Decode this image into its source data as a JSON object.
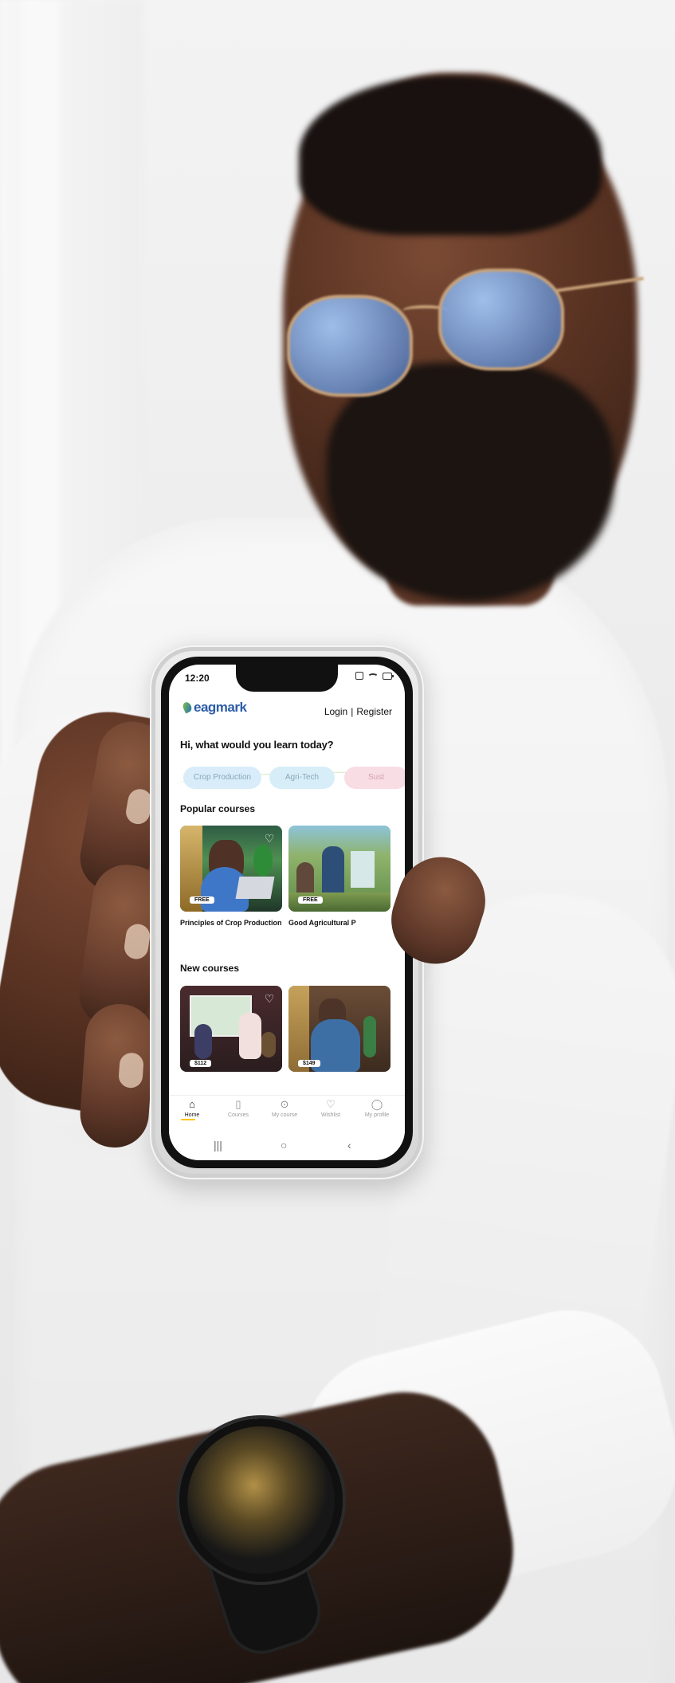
{
  "status_bar": {
    "time": "12:20",
    "icons": [
      "network-icon",
      "wifi-icon",
      "battery-icon"
    ]
  },
  "header": {
    "logo_text": "eagmark",
    "logo_tagline": "",
    "login_label": "Login",
    "separator": "|",
    "register_label": "Register"
  },
  "greeting": "Hi, what would you learn today?",
  "categories": [
    {
      "label": "Crop Production"
    },
    {
      "label": "Agri-Tech"
    },
    {
      "label": "Sust"
    }
  ],
  "sections": {
    "popular": {
      "title": "Popular courses",
      "courses": [
        {
          "title": "Principles of Crop Production",
          "badge": "FREE"
        },
        {
          "title": "Good Agricultural P",
          "badge": "FREE"
        }
      ]
    },
    "new": {
      "title": "New courses",
      "courses": [
        {
          "price": "$112"
        },
        {
          "price": "$149"
        }
      ]
    }
  },
  "bottom_nav": [
    {
      "label": "Home",
      "icon": "home-icon",
      "active": true
    },
    {
      "label": "Courses",
      "icon": "book-icon",
      "active": false
    },
    {
      "label": "My course",
      "icon": "play-circle-icon",
      "active": false
    },
    {
      "label": "Wishlist",
      "icon": "heart-icon",
      "active": false
    },
    {
      "label": "My profile",
      "icon": "user-icon",
      "active": false
    }
  ],
  "system_nav": {
    "recent": "|||",
    "home": "○",
    "back": "‹"
  },
  "icons": {
    "wishlist_heart": "♡",
    "home": "⌂",
    "courses": "▯",
    "my_course": "⊙",
    "wishlist": "♡",
    "profile": "◯"
  },
  "colors": {
    "accent": "#ffc400",
    "brand_blue": "#2c5ca7",
    "brand_green": "#86c442",
    "chip_blue": "#d8edf9",
    "chip_pink": "#f8dde5"
  }
}
